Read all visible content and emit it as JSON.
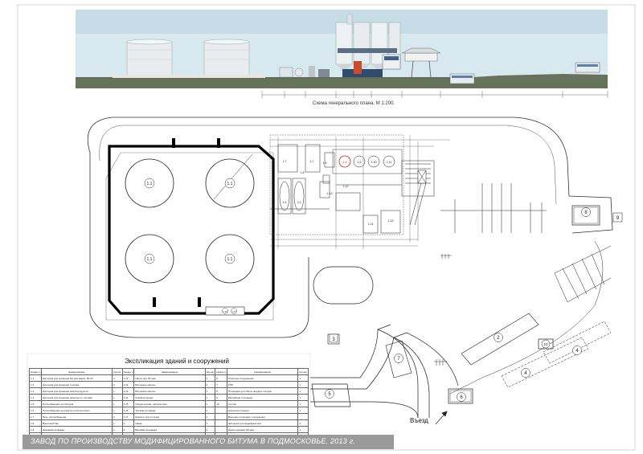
{
  "drawing": {
    "plan_caption": "Схема генерального плана. М 1:200.",
    "explication_title": "Экспликация зданий и сооружений",
    "entry_label": "Въезд",
    "footer_title": "ЗАВОД ПО ПРОИЗВОДСТВУ МОДИФИЦИРОВАННОГО БИТУМА В ПОДМОСКОВЬЕ. 2013 г.",
    "tank_labels": [
      "1.1",
      "1.1",
      "1.1",
      "1.1"
    ],
    "zone_numbers": [
      "1",
      "2",
      "3",
      "4",
      "4",
      "5",
      "6",
      "7",
      "8",
      "9",
      "10"
    ],
    "block_labels": [
      "1.7",
      "1.7",
      "1.4",
      "1.3",
      "1.8",
      "1.9",
      "1.5",
      "1.6",
      "1.10",
      "1.11",
      "1.12",
      "1.13",
      "1.14",
      "1.15",
      "1.16",
      "1.17"
    ],
    "colors": {
      "frame": "#000000",
      "footer": "#9a9a9a",
      "sky": "#cfe3ec",
      "ground": "#5f6b55",
      "line": "#222222"
    }
  },
  "explication": {
    "headers": [
      "Номер п./п.",
      "Наименование",
      "Кол-во",
      "Номер п./п.",
      "Наименование",
      "Кол-во",
      "Номер п./п.",
      "Наименование",
      "Кол-во"
    ],
    "rows": [
      [
        "1.1",
        "Цистерна для хранения битума марки, 80 м3",
        "4",
        "1.11",
        "Насос для битума",
        "1",
        "6",
        "Очистные сооружения",
        "1"
      ],
      [
        "1.2",
        "Цистерна для хранения топлива",
        "2",
        "1.12",
        "Битумные насосы",
        "2",
        "7",
        "КПП",
        "1"
      ],
      [
        "1.3",
        "Цистерна для хранения нефтепродуктов",
        "1",
        "1.13",
        "Битумные насосы",
        "1",
        "8",
        "Площадка для сбора твердых отходов",
        "1"
      ],
      [
        "1.4",
        "Цистерна для хранения дизельного топлива",
        "1",
        "1.14",
        "Компрессорная",
        "1",
        "9",
        "Выгребная площадка",
        "1"
      ],
      [
        "1.5",
        "Теплообменник для битума",
        "1",
        "1.15",
        "Операторская, лаборатория",
        "1",
        "10",
        "Септик",
        "1"
      ],
      [
        "1.6",
        "Теплообменник для масла-теплоносителя",
        "1",
        "1.16",
        "Трубная эстакада",
        "1",
        "",
        "Насосная станция",
        "1"
      ],
      [
        "1.7",
        "Печь теплообменная",
        "2",
        "1.17",
        "Емкость для отгрузки",
        "1",
        "",
        "Внешние площадки, сооружения",
        ""
      ],
      [
        "1.8",
        "Масляный бак",
        "1",
        "2",
        "Навес",
        "1",
        "",
        "Цистерна для модификатора",
        "2"
      ],
      [
        "1.9",
        "Наливная эстакада",
        "1",
        "3",
        "Весовая площадка",
        "1",
        "",
        "Насос приемки битума",
        "1"
      ],
      [
        "1.10",
        "Блок смешения",
        "1",
        "4",
        "ТП",
        "1",
        "",
        "Насос многопродуктовый",
        "1"
      ],
      [
        "",
        "",
        "",
        "5",
        "Резервуар противопожарный",
        "1",
        "",
        "",
        ""
      ]
    ]
  }
}
